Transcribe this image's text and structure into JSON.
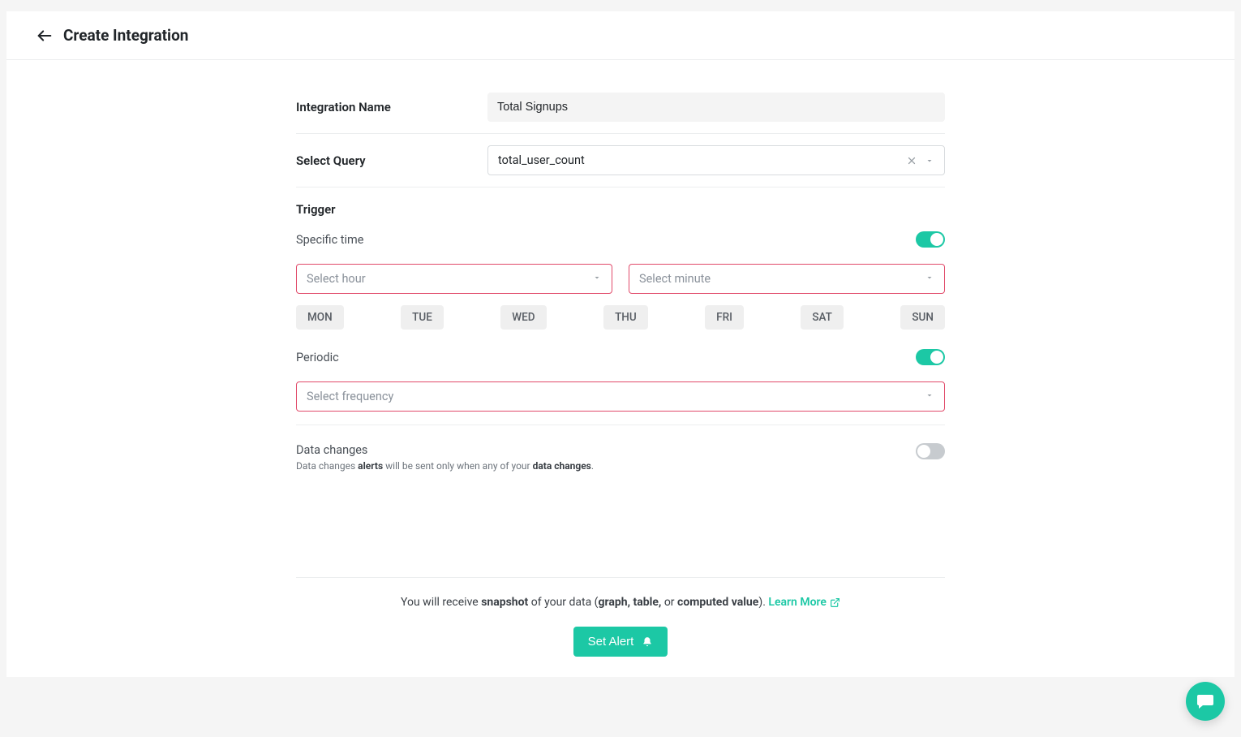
{
  "header": {
    "title": "Create Integration"
  },
  "form": {
    "integration_name": {
      "label": "Integration Name",
      "value": "Total Signups"
    },
    "select_query": {
      "label": "Select Query",
      "value": "total_user_count"
    },
    "trigger": {
      "label": "Trigger"
    },
    "specific_time": {
      "label": "Specific time",
      "hour_placeholder": "Select hour",
      "minute_placeholder": "Select minute",
      "days": [
        "MON",
        "TUE",
        "WED",
        "THU",
        "FRI",
        "SAT",
        "SUN"
      ]
    },
    "periodic": {
      "label": "Periodic",
      "freq_placeholder": "Select frequency"
    },
    "data_changes": {
      "title": "Data changes",
      "sub_pre": "Data changes ",
      "sub_bold1": "alerts",
      "sub_mid": " will be sent only when any of your ",
      "sub_bold2": "data changes",
      "sub_end": "."
    }
  },
  "footer": {
    "note_pre": "You will receive ",
    "note_b1": "snapshot",
    "note_mid1": " of your data (",
    "note_b2": "graph, table,",
    "note_mid2": " or ",
    "note_b3": "computed value",
    "note_end": "). ",
    "learn_more": "Learn More",
    "set_alert": "Set Alert"
  }
}
